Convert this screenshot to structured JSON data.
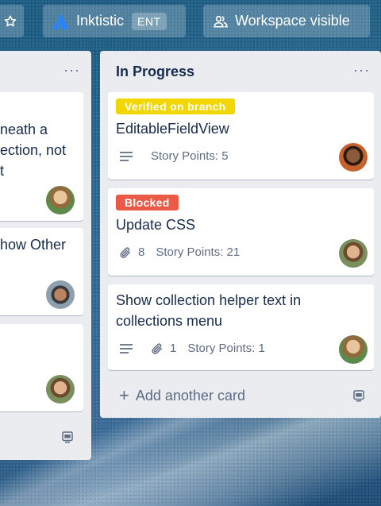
{
  "topbar": {
    "workspace_name": "Inktistic",
    "workspace_badge": "ENT",
    "visibility_label": "Workspace visible"
  },
  "lists": {
    "left": {
      "menu": "···",
      "cards": [
        {
          "line1": "neath a",
          "line2": "ection, not",
          "line3": "t"
        },
        {
          "line1": "how Other"
        },
        {}
      ]
    },
    "right": {
      "title": "In Progress",
      "menu": "···",
      "cards": [
        {
          "label": "Verified on branch",
          "label_color": "#f2d600",
          "title": "EditableFieldView",
          "story_points": "Story Points: 5"
        },
        {
          "label": "Blocked",
          "label_color": "#eb5a46",
          "title": "Update CSS",
          "attachments": "8",
          "story_points": "Story Points: 21"
        },
        {
          "title_line1": "Show collection helper text in",
          "title_line2": "collections menu",
          "attachments": "1",
          "story_points": "Story Points: 1"
        }
      ],
      "add_card_label": "Add another card"
    }
  },
  "colors": {
    "list_bg": "#ebecf0",
    "text_primary": "#172b4d",
    "text_secondary": "#5e6c84"
  },
  "icons": [
    "star-icon",
    "atlassian-logo-icon",
    "workspace-visible-icon",
    "description-icon",
    "attachment-icon",
    "card-template-icon",
    "plus-icon"
  ]
}
